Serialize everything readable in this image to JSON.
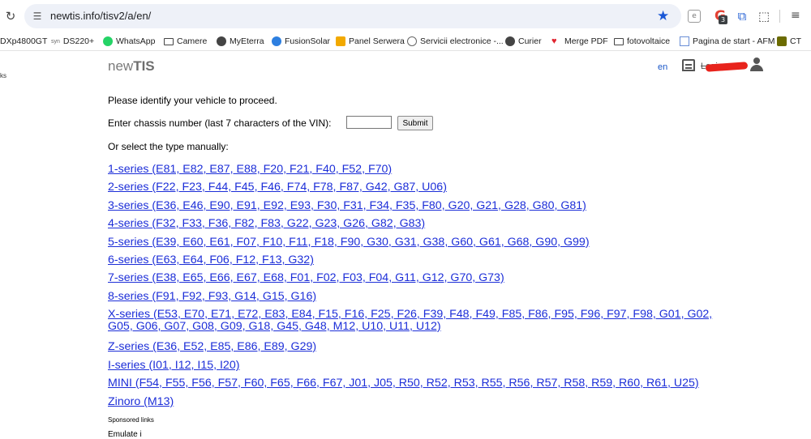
{
  "browser": {
    "url": "newtis.info/tisv2/a/en/",
    "extension_badge": "3",
    "bookmarks": [
      {
        "label": "DXp4800GT",
        "icon": "none"
      },
      {
        "label": "DS220+",
        "icon": "synology-icon"
      },
      {
        "label": "WhatsApp",
        "icon": "whatsapp-icon"
      },
      {
        "label": "Camere",
        "icon": "folder-icon"
      },
      {
        "label": "MyEterra",
        "icon": "globe-icon"
      },
      {
        "label": "FusionSolar",
        "icon": "fusionsolar-icon"
      },
      {
        "label": "Panel Serwera",
        "icon": "panel-icon"
      },
      {
        "label": "Servicii electronice -...",
        "icon": "gov-icon"
      },
      {
        "label": "Curier",
        "icon": "globe-icon"
      },
      {
        "label": "Merge PDF",
        "icon": "heart-icon"
      },
      {
        "label": "fotovoltaice",
        "icon": "folder-icon"
      },
      {
        "label": "Pagina de start - AFM",
        "icon": "page-icon"
      },
      {
        "label": "CT",
        "icon": "ct-icon"
      }
    ],
    "left_fragment": "ks"
  },
  "site": {
    "logo_prefix": "new",
    "logo_suffix": "TIS",
    "lang": "en",
    "login_text": "Login"
  },
  "form": {
    "intro": "Please identify your vehicle to proceed.",
    "vin_label": "Enter chassis number (last 7 characters of the VIN):",
    "vin_value": "",
    "submit_label": "Submit",
    "manual_label": "Or select the type manually:"
  },
  "series": [
    {
      "label": "1-series (E81, E82, E87, E88, F20, F21, F40, F52, F70)"
    },
    {
      "label": "2-series (F22, F23, F44, F45, F46, F74, F78, F87, G42, G87, U06)"
    },
    {
      "label": "3-series (E36, E46, E90, E91, E92, E93, F30, F31, F34, F35, F80, G20, G21, G28, G80, G81)"
    },
    {
      "label": "4-series (F32, F33, F36, F82, F83, G22, G23, G26, G82, G83)"
    },
    {
      "label": "5-series (E39, E60, E61, F07, F10, F11, F18, F90, G30, G31, G38, G60, G61, G68, G90, G99)"
    },
    {
      "label": "6-series (E63, E64, F06, F12, F13, G32)"
    },
    {
      "label": "7-series (E38, E65, E66, E67, E68, F01, F02, F03, F04, G11, G12, G70, G73)"
    },
    {
      "label": "8-series (F91, F92, F93, G14, G15, G16)"
    },
    {
      "label": "X-series (E53, E70, E71, E72, E83, E84, F15, F16, F25, F26, F39, F48, F49, F85, F86, F95, F96, F97, F98, G01, G02,",
      "label2": "G05, G06, G07, G08, G09, G18, G45, G48, M12, U10, U11, U12)"
    },
    {
      "label": "Z-series (E36, E52, E85, E86, E89, G29)"
    },
    {
      "label": "I-series (I01, I12, I15, I20)"
    },
    {
      "label": "MINI (F54, F55, F56, F57, F60, F65, F66, F67, J01, J05, R50, R52, R53, R55, R56, R57, R58, R59, R60, R61, U25)"
    },
    {
      "label": "Zinoro (M13)"
    }
  ],
  "footer": {
    "sponsored": "Sponsored links",
    "cut_text": "Emulate i"
  },
  "colors": {
    "link": "#1c2ed8",
    "omnibox_bg": "#eef1f8",
    "star": "#1a57d6",
    "logo": "#7a7a7a"
  }
}
